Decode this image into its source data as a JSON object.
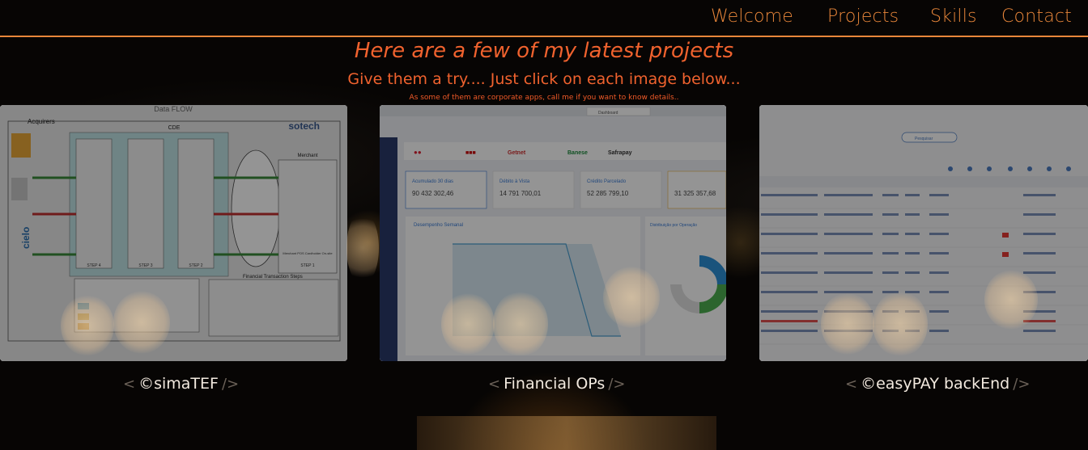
{
  "nav": {
    "items": [
      "Welcome",
      "Projects",
      "Skills",
      "Contact"
    ]
  },
  "intro": {
    "title": "Here are a few of my latest projects",
    "subtitle": "Give them a try.... Just click on each image below...",
    "note": "As some of them are corporate apps, call me if you want to know details.."
  },
  "projects": [
    {
      "caption": "©simaTEF",
      "preview": {
        "title": "Data FLOW",
        "brand": "sotech",
        "labels": [
          "Acquirers",
          "CDE",
          "Merchant",
          "STEP 4",
          "STEP 3",
          "STEP 2",
          "STEP 1",
          "Financial Transaction Steps",
          "Merchant POS Cardholder On-site"
        ]
      }
    },
    {
      "caption": "Financial OPs",
      "preview": {
        "tab": "Dashboard",
        "stats": [
          {
            "label": "Acumulado 30 dias",
            "value": "90 432 302,46"
          },
          {
            "label": "Débito à Vista",
            "value": "14 791 700,01"
          },
          {
            "label": "Crédito Parcelado",
            "value": "52 285 799,10"
          },
          {
            "label": "",
            "value": "31 325 357,68"
          }
        ],
        "chart_title": "Desempenho Semanal",
        "pie_title": "Distribuição por Operação"
      }
    },
    {
      "caption": "©easyPAY backEnd",
      "preview": {
        "search_placeholder": "Pesquisar"
      }
    }
  ],
  "caption_brackets": {
    "open": "<",
    "close": "/>"
  },
  "colors": {
    "accent": "#e8863a",
    "heading": "#f0622e"
  }
}
